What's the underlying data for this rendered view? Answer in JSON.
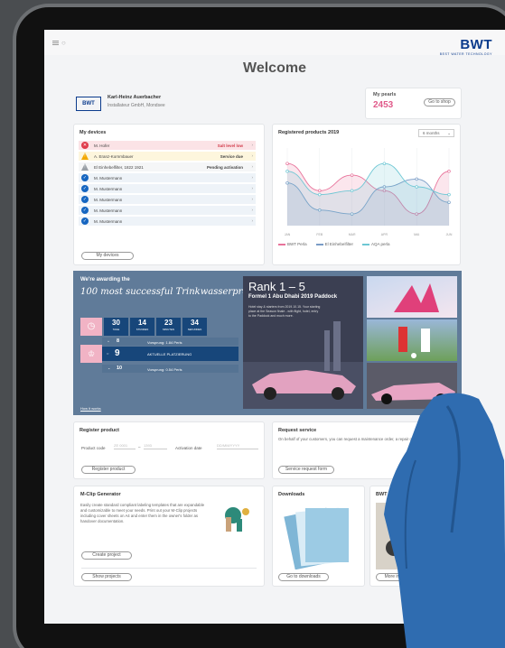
{
  "header": {
    "logo": "BWT",
    "logo_tagline": "BEST WATER TECHNOLOGY",
    "welcome": "Welcome"
  },
  "profile": {
    "badge": "BWT",
    "name": "Karl-Heinz Auerbacher",
    "company": "Installateur GmbH, Mondsee"
  },
  "pearls": {
    "label": "My pearls",
    "value": "2453",
    "button": "Go to shop"
  },
  "devices": {
    "title": "My devices",
    "button": "My devices",
    "items": [
      {
        "name": "M. Hofer",
        "status": "Salt level low",
        "icon": "x-icon",
        "color": "#e03a4a",
        "bg": "#fbe3e6",
        "status_color": "#d23a4a"
      },
      {
        "name": "A. Eranz-Kornmbauer",
        "status": "Service due",
        "icon": "warning-icon",
        "color": "#f3a800",
        "bg": "#fdf6dd",
        "status_color": "#444"
      },
      {
        "name": "El Einhebelfilter, 1822 1921",
        "status": "Pending activation",
        "icon": "warning-icon",
        "color": "#9aa0a6",
        "bg": "#f5f6f7",
        "status_color": "#444"
      },
      {
        "name": "M. Mustermann",
        "status": "",
        "icon": "check-icon",
        "color": "#1565c0",
        "bg": "#eef3f8",
        "status_color": "#444"
      },
      {
        "name": "M. Mustermann",
        "status": "",
        "icon": "check-icon",
        "color": "#1565c0",
        "bg": "#eef3f8",
        "status_color": "#444"
      },
      {
        "name": "M. Mustermann",
        "status": "",
        "icon": "check-icon",
        "color": "#1565c0",
        "bg": "#eef3f8",
        "status_color": "#444"
      },
      {
        "name": "M. Mustermann",
        "status": "",
        "icon": "check-icon",
        "color": "#1565c0",
        "bg": "#eef3f8",
        "status_color": "#444"
      },
      {
        "name": "M. Mustermann",
        "status": "",
        "icon": "check-icon",
        "color": "#1565c0",
        "bg": "#eef3f8",
        "status_color": "#444"
      }
    ]
  },
  "registered": {
    "title": "Registered products 2019",
    "period": "6 months"
  },
  "chart_data": {
    "type": "area",
    "title": "Registered products 2019",
    "categories": [
      "JAN",
      "FEB",
      "MAR",
      "APR",
      "MAI",
      "JUN"
    ],
    "series": [
      {
        "name": "BWT Perla",
        "color": "#e8739b",
        "values": [
          8,
          4.5,
          6.5,
          4.5,
          1.5,
          7
        ]
      },
      {
        "name": "El Einhebelfilter",
        "color": "#7a9cc6",
        "values": [
          5.5,
          2,
          1.5,
          5,
          6,
          3
        ]
      },
      {
        "name": "AQA perla",
        "color": "#6ec7d4",
        "values": [
          7,
          4,
          4.5,
          8,
          5,
          4
        ]
      }
    ],
    "ylim": [
      0,
      10
    ]
  },
  "banner": {
    "subtitle": "We're awarding the",
    "title": "100 most successful Trinkwasserprofis",
    "countdown": [
      {
        "value": "30",
        "unit": "TAGE"
      },
      {
        "value": "14",
        "unit": "STUNDEN"
      },
      {
        "value": "23",
        "unit": "MINUTEN"
      },
      {
        "value": "34",
        "unit": "SEKUNDEN"
      }
    ],
    "rank_up": {
      "value": "8",
      "text": "Vorsprung: 1.84 Perls"
    },
    "current": {
      "value": "9",
      "text": "AKTUELLE PLATZIERUNG"
    },
    "rank_down": {
      "value": "10",
      "text": "Vorsprung: 0.54 Perls"
    },
    "link": "How it works",
    "rank_title": "Rank 1 – 5",
    "rank_subtitle": "Formel 1 Abu Dhabi 2019 Paddock",
    "rank_text": "Hotel stay & starters from 2019.10.15. Your starting place at the Season finale - with flight, hotel, entry to the Paddock and much more."
  },
  "register": {
    "title": "Register product",
    "code_label": "Product code",
    "code_placeholder_a": "ZE 0001",
    "code_placeholder_b": "1393",
    "date_label": "Activation date",
    "date_placeholder": "DD/MM/YYYY",
    "button": "Register product"
  },
  "service": {
    "title": "Request service",
    "text": "On behalf of your customers, you can request a maintenance order, a repair order or commissioning.",
    "button": "Service request form"
  },
  "mclip": {
    "title": "M-Clip Generator",
    "text": "Easily create standard compliant labeling templates that are expandable and customizable to meet your needs. Print out your M-Clip projects including cover sheets on A4 and enter them in the owner's folder as handover documentation.",
    "create_button": "Create project",
    "show_button": "Show projects"
  },
  "downloads": {
    "title": "Downloads",
    "button": "Go to downloads"
  },
  "academy": {
    "title": "BWT Academy",
    "button": "More info"
  }
}
